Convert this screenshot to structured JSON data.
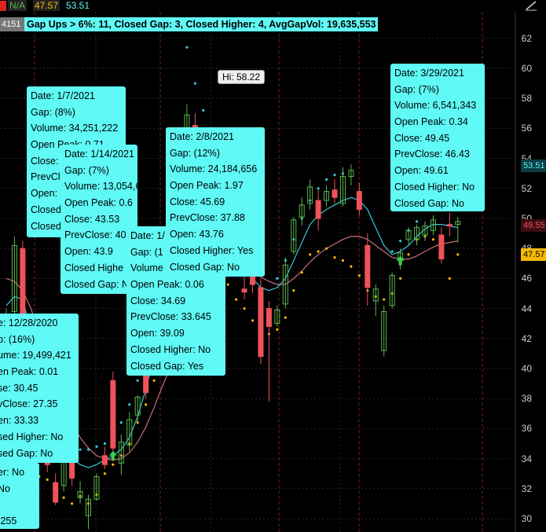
{
  "header": {
    "na_label": "N/A",
    "price1": "47.57",
    "price2": "53.51",
    "symbol_fragment": "4151",
    "summary": "Gap Ups > 6%: 11, Closed Gap: 3, Closed Higher: 4, AvgGapVol: 19,635,553"
  },
  "hi_label": "Hi: 58.22",
  "colors": {
    "tooltip_bg": "#5ff9f6",
    "up_candle": "#5ab54a",
    "down_candle": "#f0525a",
    "fast_ma": "#35c8d8",
    "slow_ma": "#c8707a",
    "gap_dot": "#f5b800",
    "grid": "#2a2a2a",
    "vline": "#7a1a22"
  },
  "price_labels": [
    {
      "value": "53.51",
      "color": "#5ff9f6"
    },
    {
      "value": "49.55",
      "color": "#f0525a"
    },
    {
      "value": "47.57",
      "color": "#f5b800"
    }
  ],
  "tooltips": [
    {
      "id": "tip-0107",
      "lines": [
        "Date: 1/7/2021",
        "Gap: (8%)",
        "Volume: 34,251,222",
        "Open Peak: 0.71",
        "Close: 4",
        "PrevCl",
        "Open: 4",
        "Closed",
        "Closed"
      ]
    },
    {
      "id": "tip-1228",
      "lines": [
        "e: 12/28/2020",
        "p: (16%)",
        "ume: 19,499,421",
        "en Peak: 0.01",
        "se: 30.45",
        "vClose: 27.35",
        "en: 33.33",
        "sed Higher: No",
        "sed Gap: No"
      ]
    },
    {
      "id": "tip-left-fragment",
      "lines": [
        "er: No",
        "No",
        "",
        ".255"
      ]
    },
    {
      "id": "tip-0114",
      "lines": [
        "Date: 1/14/2021",
        "Gap: (7%)",
        "Volume: 13,054,648",
        "Open Peak: 0.6",
        "Close: 43.53",
        "PrevClose: 40",
        "Open: 43.9",
        "Closed Highe",
        "Closed Gap: N"
      ]
    },
    {
      "id": "tip-0128",
      "lines": [
        "Date: 1/",
        "Gap: (1",
        "Volume",
        "Open Peak: 0.06",
        "Close: 34.69",
        "PrevClose: 33.645",
        "Open: 39.09",
        "Closed Higher: No",
        "Closed Gap: Yes"
      ]
    },
    {
      "id": "tip-0208",
      "lines": [
        "Date: 2/8/2021",
        "Gap: (12%)",
        "Volume: 24,184,656",
        "Open Peak: 1.97",
        "Close: 45.69",
        "PrevClose: 37.88",
        "Open: 43.76",
        "Closed Higher: Yes",
        "Closed Gap: No"
      ]
    },
    {
      "id": "tip-0329",
      "lines": [
        "Date: 3/29/2021",
        "Gap: (7%)",
        "Volume: 6,541,343",
        "Open Peak: 0.34",
        "Close: 49.45",
        "PrevClose: 46.43",
        "Open: 49.61",
        "Closed Higher: No",
        "Closed Gap: No"
      ]
    }
  ],
  "chart_data": {
    "type": "candlestick",
    "ylim": [
      29,
      64
    ],
    "y_ticks": [
      30,
      32,
      34,
      36,
      38,
      40,
      42,
      44,
      46,
      48,
      50,
      52,
      54,
      56,
      58,
      60,
      62
    ],
    "candles": [
      {
        "o": 41.0,
        "h": 44.0,
        "l": 40.5,
        "c": 42.8
      },
      {
        "o": 43.8,
        "h": 48.8,
        "l": 42.9,
        "c": 48.2
      },
      {
        "o": 48.0,
        "h": 48.5,
        "l": 42.8,
        "c": 43.5
      },
      {
        "o": 39.2,
        "h": 40.0,
        "l": 36.8,
        "c": 37.2
      },
      {
        "o": 36.8,
        "h": 37.5,
        "l": 34.0,
        "c": 34.5
      },
      {
        "o": 34.2,
        "h": 35.0,
        "l": 33.1,
        "c": 33.6
      },
      {
        "o": 32.4,
        "h": 33.0,
        "l": 30.9,
        "c": 31.1
      },
      {
        "o": 32.2,
        "h": 35.2,
        "l": 31.8,
        "c": 34.8
      },
      {
        "o": 34.6,
        "h": 36.0,
        "l": 32.2,
        "c": 32.7
      },
      {
        "o": 31.4,
        "h": 32.5,
        "l": 31.0,
        "c": 31.8
      },
      {
        "o": 30.2,
        "h": 31.6,
        "l": 29.3,
        "c": 31.3
      },
      {
        "o": 31.3,
        "h": 33.0,
        "l": 31.2,
        "c": 32.8
      },
      {
        "o": 34.2,
        "h": 34.8,
        "l": 33.3,
        "c": 33.6
      },
      {
        "o": 39.2,
        "h": 39.8,
        "l": 33.8,
        "c": 34.7
      },
      {
        "o": 33.7,
        "h": 35.6,
        "l": 32.9,
        "c": 35.1
      },
      {
        "o": 34.9,
        "h": 37.1,
        "l": 34.5,
        "c": 36.6
      },
      {
        "o": 36.9,
        "h": 38.2,
        "l": 36.5,
        "c": 38.1
      },
      {
        "o": 39.6,
        "h": 40.3,
        "l": 38.0,
        "c": 38.4
      },
      {
        "o": 41.6,
        "h": 45.5,
        "l": 40.8,
        "c": 45.1
      },
      {
        "o": 45.0,
        "h": 46.2,
        "l": 44.2,
        "c": 45.4
      },
      {
        "o": 43.8,
        "h": 46.0,
        "l": 42.6,
        "c": 45.7
      },
      {
        "o": 49.5,
        "h": 51.3,
        "l": 47.6,
        "c": 50.4
      },
      {
        "o": 53.0,
        "h": 57.6,
        "l": 52.2,
        "c": 56.9
      },
      {
        "o": 56.2,
        "h": 57.0,
        "l": 53.2,
        "c": 54.2
      },
      {
        "o": 52.2,
        "h": 53.2,
        "l": 48.8,
        "c": 49.5
      },
      {
        "o": 48.8,
        "h": 49.6,
        "l": 47.4,
        "c": 48.3
      },
      {
        "o": 46.4,
        "h": 47.2,
        "l": 44.2,
        "c": 44.6
      },
      {
        "o": 46.6,
        "h": 48.3,
        "l": 46.2,
        "c": 47.7
      },
      {
        "o": 47.9,
        "h": 48.5,
        "l": 46.3,
        "c": 46.6
      },
      {
        "o": 45.3,
        "h": 46.4,
        "l": 44.6,
        "c": 45.1
      },
      {
        "o": 47.6,
        "h": 48.6,
        "l": 45.0,
        "c": 45.6
      },
      {
        "o": 45.4,
        "h": 46.0,
        "l": 40.3,
        "c": 40.8
      },
      {
        "o": 44.0,
        "h": 44.5,
        "l": 37.8,
        "c": 42.8
      },
      {
        "o": 43.0,
        "h": 44.2,
        "l": 42.8,
        "c": 43.9
      },
      {
        "o": 44.3,
        "h": 47.4,
        "l": 44.0,
        "c": 46.9
      },
      {
        "o": 47.8,
        "h": 50.1,
        "l": 47.6,
        "c": 49.9
      },
      {
        "o": 50.1,
        "h": 51.4,
        "l": 49.5,
        "c": 50.9
      },
      {
        "o": 51.0,
        "h": 52.6,
        "l": 50.6,
        "c": 52.1
      },
      {
        "o": 51.2,
        "h": 51.9,
        "l": 49.2,
        "c": 50.0
      },
      {
        "o": 51.2,
        "h": 52.2,
        "l": 50.8,
        "c": 51.8
      },
      {
        "o": 51.9,
        "h": 52.6,
        "l": 51.0,
        "c": 51.4
      },
      {
        "o": 51.0,
        "h": 53.4,
        "l": 50.8,
        "c": 52.8
      },
      {
        "o": 52.8,
        "h": 53.6,
        "l": 52.2,
        "c": 53.2
      },
      {
        "o": 51.8,
        "h": 52.4,
        "l": 50.2,
        "c": 50.6
      },
      {
        "o": 48.2,
        "h": 49.0,
        "l": 44.2,
        "c": 45.4
      },
      {
        "o": 44.5,
        "h": 45.6,
        "l": 43.5,
        "c": 45.3
      },
      {
        "o": 41.2,
        "h": 44.2,
        "l": 40.8,
        "c": 43.8
      },
      {
        "o": 44.2,
        "h": 46.4,
        "l": 44.0,
        "c": 46.2
      },
      {
        "o": 47.2,
        "h": 48.0,
        "l": 46.6,
        "c": 47.7
      },
      {
        "o": 48.6,
        "h": 49.4,
        "l": 48.2,
        "c": 49.2
      },
      {
        "o": 48.6,
        "h": 49.6,
        "l": 48.2,
        "c": 49.4
      },
      {
        "o": 48.9,
        "h": 49.8,
        "l": 48.5,
        "c": 49.5
      },
      {
        "o": 49.2,
        "h": 50.2,
        "l": 48.9,
        "c": 49.9
      },
      {
        "o": 48.9,
        "h": 49.4,
        "l": 47.0,
        "c": 47.3
      },
      {
        "o": 49.6,
        "h": 50.4,
        "l": 48.8,
        "c": 49.5
      },
      {
        "o": 49.6,
        "h": 50.1,
        "l": 48.4,
        "c": 49.8
      }
    ],
    "fast_ma": [
      44.2,
      44.8,
      44.6,
      42.5,
      39.6,
      37.0,
      35.4,
      34.4,
      34.0,
      33.6,
      33.4,
      33.6,
      33.9,
      34.2,
      34.6,
      35.4,
      36.8,
      38.6,
      40.8,
      43.0,
      44.5,
      46.0,
      47.8,
      49.0,
      49.2,
      48.6,
      47.6,
      47.2,
      47.0,
      46.5,
      46.0,
      45.4,
      45.2,
      45.4,
      46.0,
      47.2,
      48.4,
      49.6,
      50.2,
      50.6,
      50.9,
      51.2,
      51.4,
      51.2,
      50.6,
      49.4,
      48.2,
      47.6,
      47.8,
      48.2,
      48.8,
      49.3,
      49.6,
      49.6,
      49.5,
      49.4
    ],
    "slow_ma": [
      46.0,
      45.8,
      45.2,
      44.0,
      42.4,
      40.8,
      39.2,
      37.6,
      36.4,
      35.4,
      34.7,
      34.2,
      34.0,
      33.9,
      34.0,
      34.4,
      35.1,
      36.1,
      37.4,
      38.8,
      40.1,
      41.5,
      42.9,
      44.1,
      44.9,
      45.5,
      45.9,
      46.2,
      46.4,
      46.5,
      46.4,
      46.1,
      45.8,
      45.6,
      45.6,
      46.0,
      46.5,
      47.1,
      47.6,
      48.0,
      48.3,
      48.6,
      48.8,
      48.8,
      48.6,
      48.2,
      47.8,
      47.4,
      47.3,
      47.3,
      47.5,
      47.8,
      48.1,
      48.3,
      48.4,
      48.5
    ],
    "upper_dots": [
      null,
      null,
      null,
      null,
      38.5,
      37.0,
      36.2,
      35.2,
      34.9,
      34.6,
      34.6,
      34.8,
      35.0,
      35.6,
      36.4,
      37.6,
      39.2,
      41.0,
      43.0,
      null,
      null,
      null,
      61.4,
      59.0,
      57.2,
      55.8,
      54.4,
      53.4,
      52.6,
      51.8,
      null,
      null,
      null,
      46.0,
      47.2,
      48.6,
      50.0,
      51.2,
      52.0,
      52.6,
      52.9,
      53.0,
      null,
      null,
      null,
      null,
      null,
      47.8,
      48.5,
      49.2,
      49.8,
      null,
      null,
      null,
      null,
      null
    ],
    "lower_dots": [
      null,
      null,
      null,
      33.0,
      32.8,
      32.6,
      32.0,
      31.4,
      31.0,
      31.5,
      31.0,
      31.6,
      33.0,
      33.6,
      34.2,
      35.0,
      36.4,
      37.6,
      39.2,
      40.6,
      41.8,
      44.0,
      45.8,
      47.2,
      47.8,
      47.6,
      46.6,
      45.6,
      44.6,
      44.0,
      43.2,
      42.8,
      42.3,
      42.6,
      43.4,
      45.2,
      46.4,
      47.6,
      47.8,
      48.0,
      47.4,
      47.2,
      46.8,
      46.2,
      45.2,
      44.8,
      44.6,
      45.0,
      46.0,
      47.6,
      48.6,
      48.8,
      48.6,
      47.4,
      46.0,
      47.6
    ],
    "gap_arrows": [
      {
        "index": 13,
        "y": 34.2
      },
      {
        "index": 48,
        "y": 47.2
      }
    ]
  }
}
